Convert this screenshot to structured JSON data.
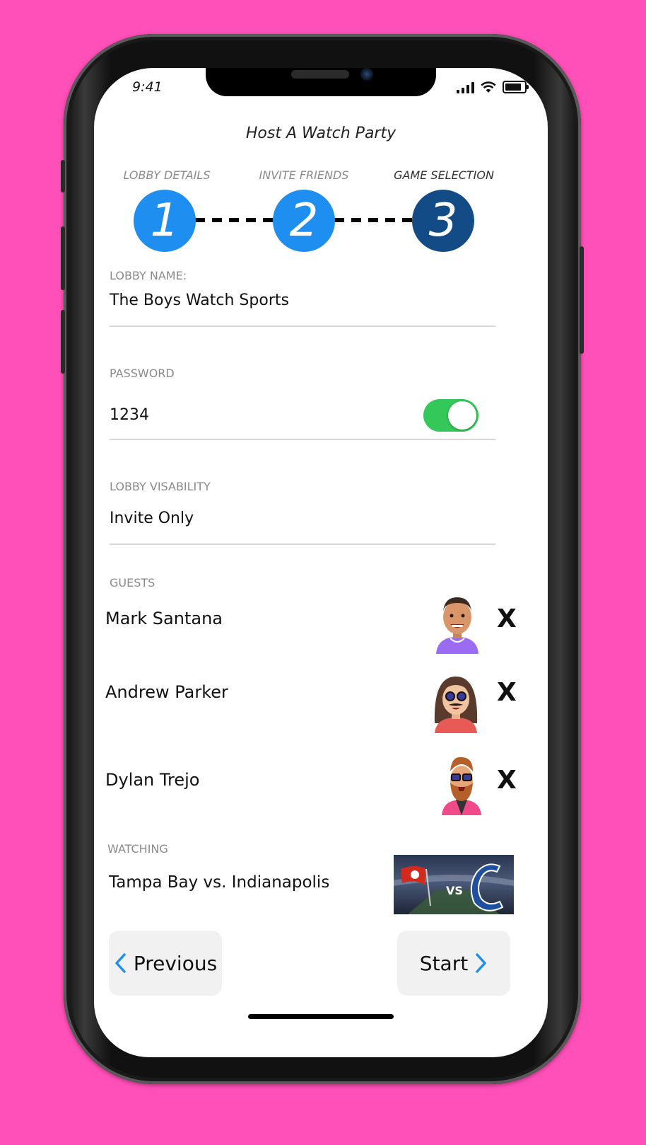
{
  "status_bar": {
    "time": "9:41"
  },
  "header": {
    "title": "Host A Watch Party"
  },
  "steps": [
    {
      "number": "1",
      "label": "LOBBY DETAILS"
    },
    {
      "number": "2",
      "label": "INVITE FRIENDS"
    },
    {
      "number": "3",
      "label": "GAME SELECTION"
    }
  ],
  "lobby": {
    "label": "LOBBY NAME:",
    "value": "The Boys Watch Sports"
  },
  "password": {
    "label": "PASSWORD",
    "value": "1234",
    "toggle_on": true
  },
  "visibility": {
    "label": "LOBBY VISABILITY",
    "value": "Invite Only"
  },
  "guests": {
    "label": "GUESTS",
    "items": [
      {
        "name": "Mark Santana",
        "remove": "X"
      },
      {
        "name": "Andrew Parker",
        "remove": "X"
      },
      {
        "name": "Dylan Trejo",
        "remove": "X"
      }
    ]
  },
  "watching": {
    "label": "WATCHING",
    "value": "Tampa Bay vs. Indianapolis",
    "vs_text": "VS"
  },
  "nav": {
    "previous": "Previous",
    "start": "Start"
  },
  "colors": {
    "background": "#ff4fb8",
    "step_active": "#134b86",
    "step": "#1e8ef0",
    "toggle_on": "#34c759",
    "chevron": "#1e8ef0"
  }
}
